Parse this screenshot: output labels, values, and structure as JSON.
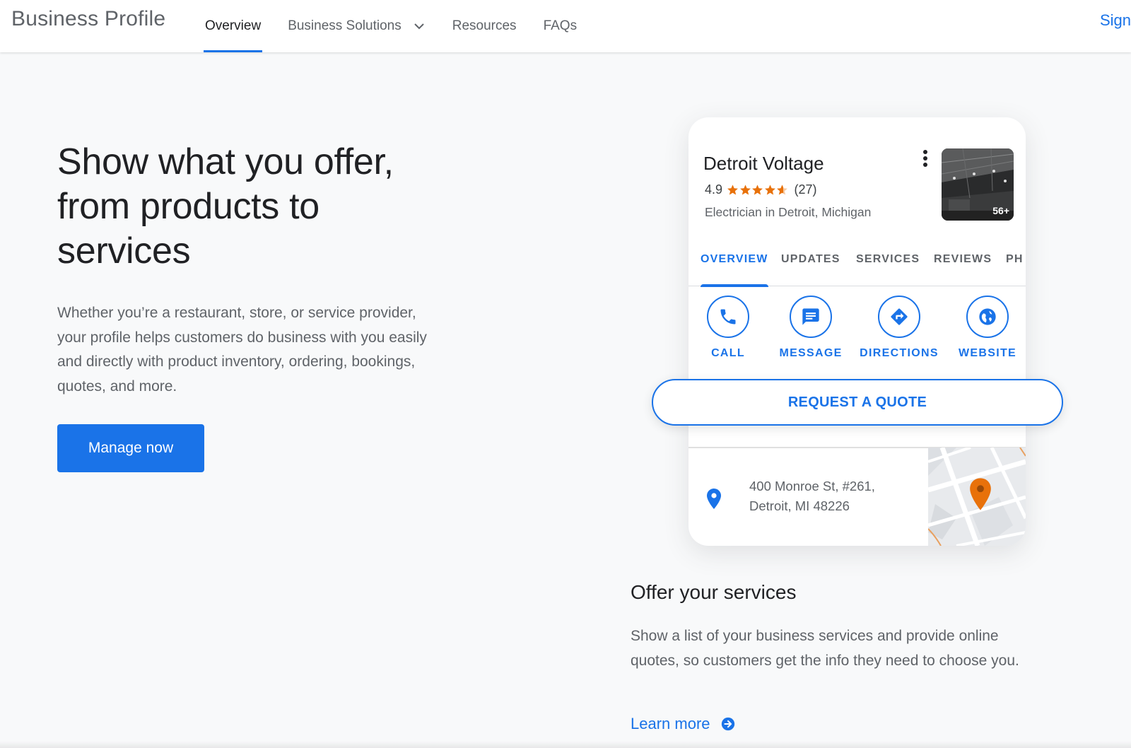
{
  "header": {
    "brand": "Business Profile",
    "nav": [
      {
        "label": "Overview",
        "active": true
      },
      {
        "label": "Business Solutions",
        "has_dropdown": true
      },
      {
        "label": "Resources"
      },
      {
        "label": "FAQs"
      }
    ],
    "signin_label": "Sign"
  },
  "hero": {
    "title": "Show what you offer, from products to services",
    "body": "Whether you’re a restaurant, store, or service provider, your profile helps customers do business with you easily and directly with product inventory, ordering, bookings, quotes, and more.",
    "cta_label": "Manage now"
  },
  "profile_card": {
    "business_name": "Detroit Voltage",
    "rating": "4.9",
    "rating_value": 4.9,
    "review_count": "(27)",
    "category": "Electrician in Detroit, Michigan",
    "photo_count": "56+",
    "tabs": [
      "OVERVIEW",
      "UPDATES",
      "SERVICES",
      "REVIEWS",
      "PH"
    ],
    "actions": [
      {
        "label": "CALL",
        "icon": "phone-icon"
      },
      {
        "label": "MESSAGE",
        "icon": "message-icon"
      },
      {
        "label": "DIRECTIONS",
        "icon": "directions-icon"
      },
      {
        "label": "WEBSITE",
        "icon": "globe-icon"
      }
    ],
    "quote_label": "REQUEST A QUOTE",
    "address_line1": "400 Monroe St, #261,",
    "address_line2": "Detroit, MI 48226"
  },
  "offer": {
    "title": "Offer your services",
    "body": "Show a list of your business services and provide online quotes, so customers get the info they need to choose you.",
    "link_label": "Learn more"
  },
  "colors": {
    "accent": "#1a73e8",
    "star": "#e8710a",
    "map_pin": "#e8710a",
    "background": "#f8f9fa"
  }
}
